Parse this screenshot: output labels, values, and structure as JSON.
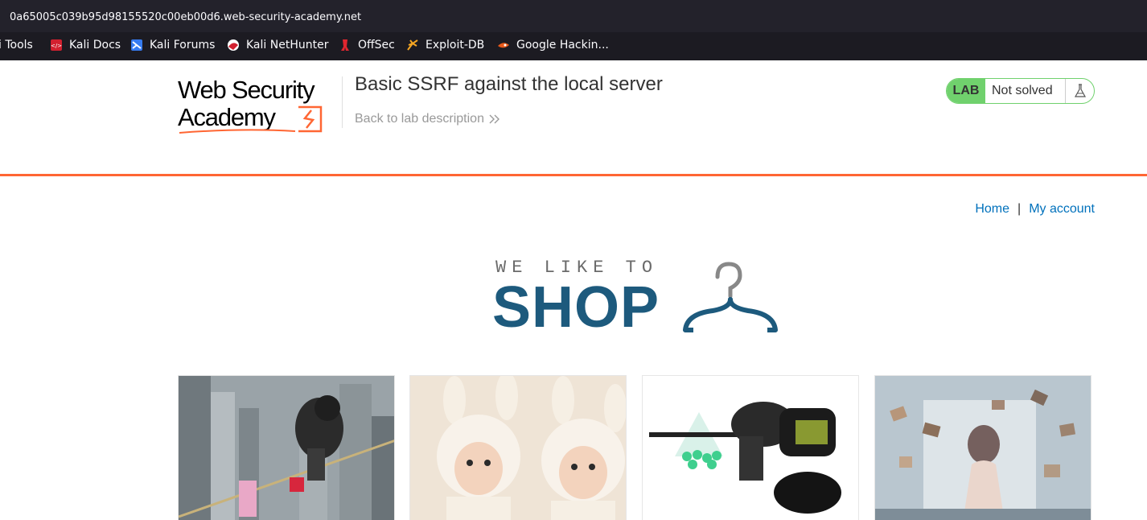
{
  "browser": {
    "url": "0a65005c039b95d98155520c00eb00d6.web-security-academy.net",
    "bookmarks": [
      {
        "label": "i Tools",
        "icon": "kali-tools-icon"
      },
      {
        "label": "Kali Docs",
        "icon": "kali-docs-icon"
      },
      {
        "label": "Kali Forums",
        "icon": "kali-forums-icon"
      },
      {
        "label": "Kali NetHunter",
        "icon": "kali-nethunter-icon"
      },
      {
        "label": "OffSec",
        "icon": "offsec-icon"
      },
      {
        "label": "Exploit-DB",
        "icon": "exploit-db-icon"
      },
      {
        "label": "Google Hackin...",
        "icon": "google-hacking-icon"
      }
    ]
  },
  "header": {
    "logo_line1": "Web Security",
    "logo_line2": "Academy",
    "title": "Basic SSRF against the local server",
    "back_link": "Back to lab description",
    "status_badge": "LAB",
    "status_text": "Not solved",
    "colors": {
      "accent": "#ff6633",
      "lab_green": "#70d16d",
      "link": "#0071bc"
    }
  },
  "nav": {
    "home": "Home",
    "separator": "|",
    "my_account": "My account"
  },
  "banner": {
    "small": "WE LIKE TO",
    "big": "SHOP"
  },
  "products": [
    {
      "image": "child-on-rope-over-city-image"
    },
    {
      "image": "babies-in-bunny-hats-image"
    },
    {
      "image": "paintball-gun-image"
    },
    {
      "image": "woman-with-flying-books-image"
    }
  ]
}
